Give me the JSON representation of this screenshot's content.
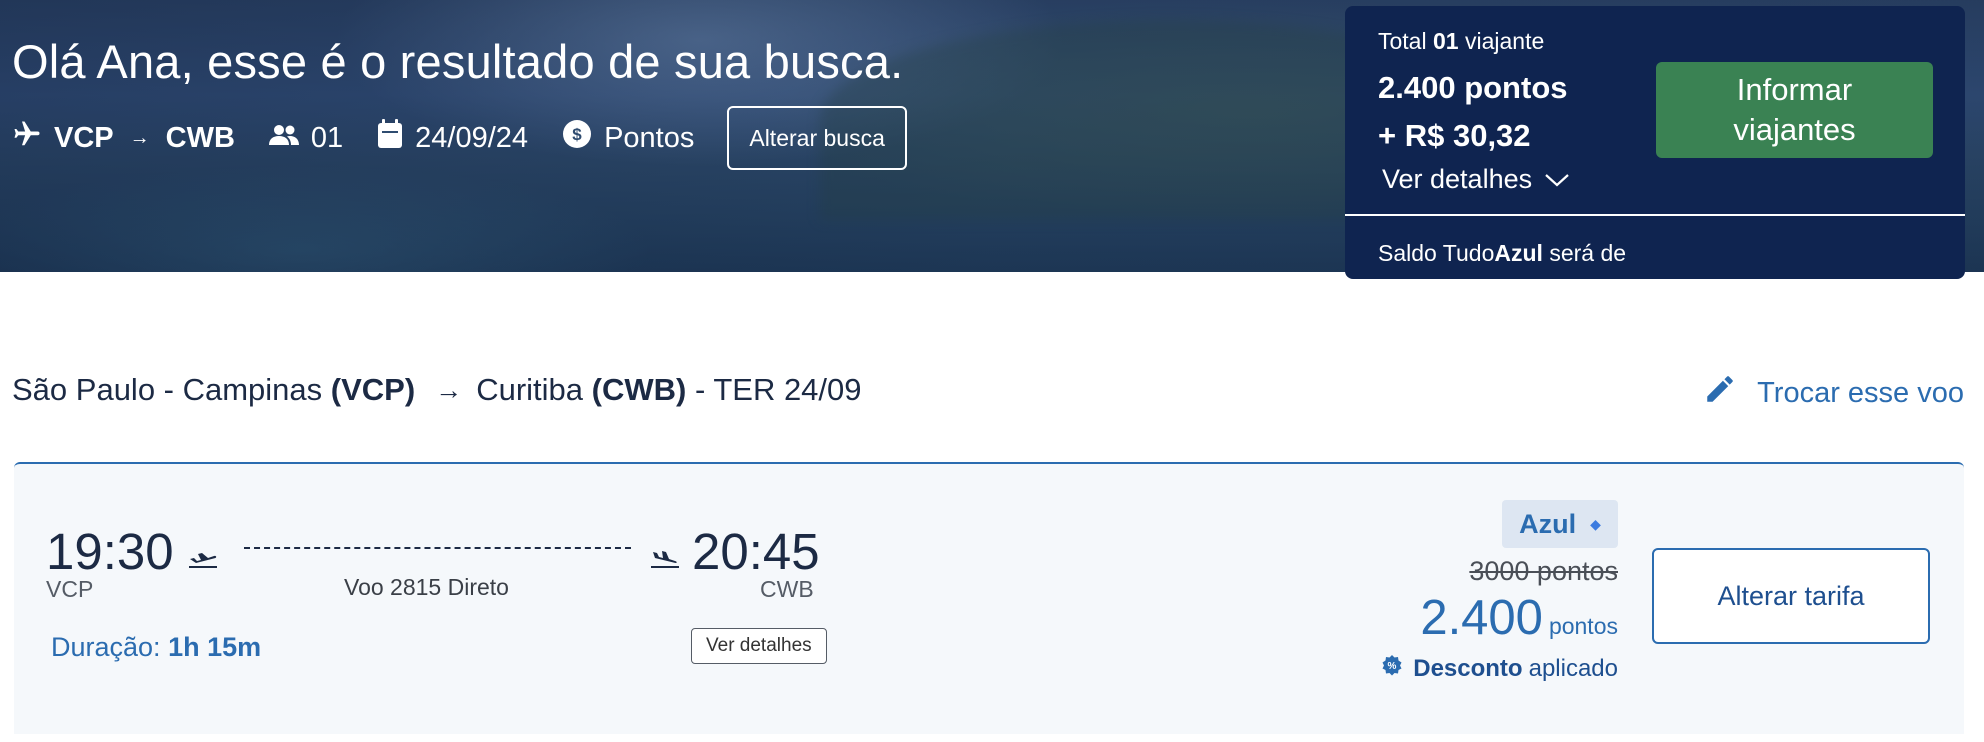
{
  "hero": {
    "title": "Olá Ana, esse é o resultado de sua busca.",
    "origin": "VCP",
    "route_arrow": "→",
    "destination": "CWB",
    "passengers": "01",
    "date": "24/09/24",
    "payment": "Pontos",
    "alter_search_label": "Alterar busca"
  },
  "summary": {
    "total_prefix": "Total",
    "total_count": "01",
    "total_suffix": "viajante",
    "points": "2.400 pontos",
    "cash": "+ R$ 30,32",
    "details_label": "Ver detalhes",
    "inform_line1": "Informar",
    "inform_line2": "viajantes",
    "saldo_prefix": "Saldo Tudo",
    "saldo_brand": "Azul",
    "saldo_suffix": "será de"
  },
  "route_header": {
    "origin_city": "São Paulo - Campinas",
    "origin_code": "(VCP)",
    "arrow": "→",
    "dest_city": "Curitiba",
    "dest_code": "(CWB)",
    "date_text": "- TER 24/09",
    "change_label": "Trocar esse voo"
  },
  "flight": {
    "departure_time": "19:30",
    "departure_code": "VCP",
    "arrival_time": "20:45",
    "arrival_code": "CWB",
    "flight_info": "Voo 2815 Direto",
    "duration_label": "Duração:",
    "duration_value": "1h 15m",
    "details_label": "Ver detalhes",
    "fare_name": "Azul",
    "old_price": "3000 pontos",
    "new_price": "2.400",
    "new_price_unit": "pontos",
    "discount_bold": "Desconto",
    "discount_rest": "aplicado",
    "alter_fare_label": "Alterar tarifa"
  },
  "colors": {
    "navy": "#0f2450",
    "green_button": "#3a8253",
    "link_blue": "#2b6cb0"
  },
  "icons": [
    "airplane-icon",
    "passengers-icon",
    "calendar-icon",
    "coin-icon",
    "chevron-down-icon",
    "pencil-icon",
    "takeoff-icon",
    "landing-icon",
    "discount-badge-icon"
  ]
}
